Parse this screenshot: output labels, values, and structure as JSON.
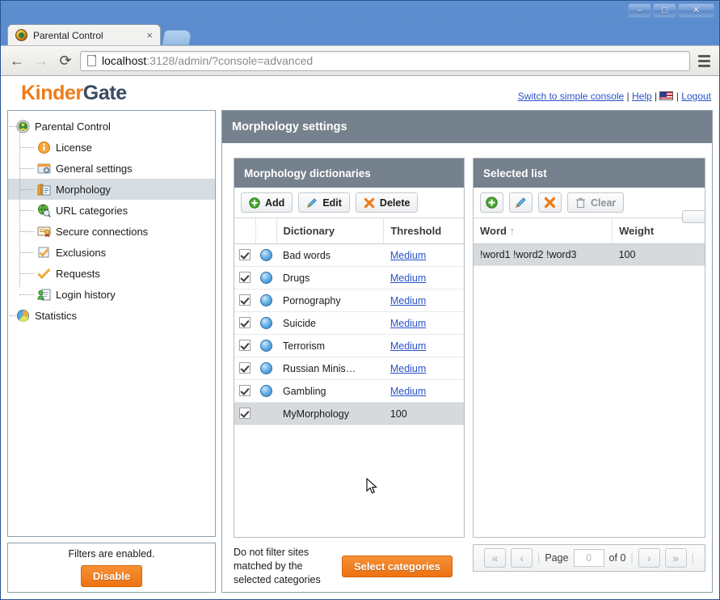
{
  "browser": {
    "tab_title": "Parental Control",
    "tab_close": "×",
    "back_icon": "←",
    "forward_icon": "→",
    "reload_icon": "⟳",
    "url_host": "localhost",
    "url_rest": ":3128/admin/?console=advanced",
    "minimize": "–",
    "maximize": "□",
    "close": "✕"
  },
  "brand": {
    "part1": "Kinder",
    "part2": "Gate"
  },
  "toplinks": {
    "switch": "Switch to simple console",
    "help": "Help",
    "logout": "Logout",
    "sep": "|",
    "flag_alt": "us-flag-icon"
  },
  "sidebar": {
    "items": [
      {
        "label": "Parental Control",
        "icon": "shield-icon",
        "level": 0,
        "selected": false
      },
      {
        "label": "License",
        "icon": "info-icon",
        "level": 1,
        "selected": false
      },
      {
        "label": "General settings",
        "icon": "settings-icon",
        "level": 1,
        "selected": false
      },
      {
        "label": "Morphology",
        "icon": "morphology-icon",
        "level": 1,
        "selected": true
      },
      {
        "label": "URL categories",
        "icon": "url-categories-icon",
        "level": 1,
        "selected": false
      },
      {
        "label": "Secure connections",
        "icon": "certificate-icon",
        "level": 1,
        "selected": false
      },
      {
        "label": "Exclusions",
        "icon": "exclusions-icon",
        "level": 1,
        "selected": false
      },
      {
        "label": "Requests",
        "icon": "check-icon",
        "level": 1,
        "selected": false
      },
      {
        "label": "Login history",
        "icon": "login-history-icon",
        "level": 1,
        "selected": false
      },
      {
        "label": "Statistics",
        "icon": "statistics-icon",
        "level": 0,
        "selected": false
      }
    ]
  },
  "filter_status": {
    "text": "Filters are enabled.",
    "button": "Disable"
  },
  "main": {
    "title": "Morphology settings",
    "dictionaries_panel": {
      "title": "Morphology dictionaries",
      "toolbar": {
        "add": "Add",
        "edit": "Edit",
        "delete": "Delete"
      },
      "columns": [
        "Dictionary",
        "Threshold"
      ],
      "rows": [
        {
          "checked": true,
          "icon": true,
          "name": "Bad words",
          "threshold": "Medium",
          "link": true,
          "highlighted": false
        },
        {
          "checked": true,
          "icon": true,
          "name": "Drugs",
          "threshold": "Medium",
          "link": true,
          "highlighted": false
        },
        {
          "checked": true,
          "icon": true,
          "name": "Pornography",
          "threshold": "Medium",
          "link": true,
          "highlighted": false
        },
        {
          "checked": true,
          "icon": true,
          "name": "Suicide",
          "threshold": "Medium",
          "link": true,
          "highlighted": false
        },
        {
          "checked": true,
          "icon": true,
          "name": "Terrorism",
          "threshold": "Medium",
          "link": true,
          "highlighted": false
        },
        {
          "checked": true,
          "icon": true,
          "name": "Russian Minis…",
          "threshold": "Medium",
          "link": true,
          "highlighted": false
        },
        {
          "checked": true,
          "icon": true,
          "name": "Gambling",
          "threshold": "Medium",
          "link": true,
          "highlighted": false
        },
        {
          "checked": true,
          "icon": false,
          "name": "MyMorphology",
          "threshold": "100",
          "link": false,
          "highlighted": true
        }
      ],
      "footer_note": "Do not filter sites matched by the selected categories",
      "footer_button": "Select categories"
    },
    "selected_list_panel": {
      "title": "Selected list",
      "toolbar": {
        "add": "⊕",
        "edit": "✎",
        "delete": "✖",
        "clear": "Clear"
      },
      "columns": [
        "Word",
        "Weight"
      ],
      "sort_indicator": "↑",
      "rows": [
        {
          "word": "!word1 !word2 !word3",
          "weight": "100",
          "highlighted": true
        }
      ],
      "pager": {
        "first": "«",
        "prev": "‹",
        "page_label": "Page",
        "page_value": "0",
        "of_label": "of 0",
        "next": "›",
        "last": "»"
      }
    }
  },
  "colors": {
    "brand_orange": "#ef7b1a",
    "brand_dark": "#3a4a63",
    "header_slate": "#75818c",
    "link_blue": "#2a52c8",
    "row_highlight": "#d6dadd"
  }
}
